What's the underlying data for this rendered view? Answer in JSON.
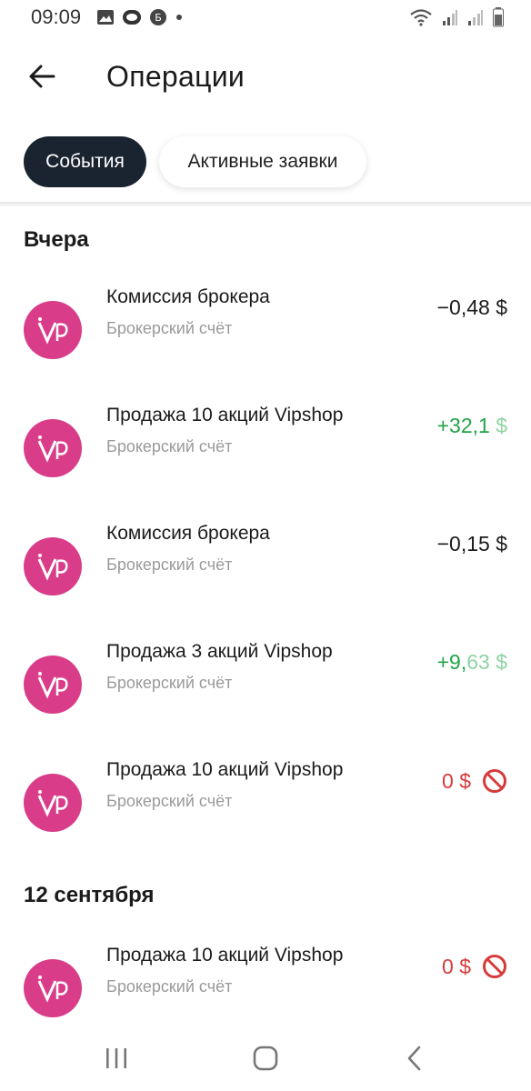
{
  "status_bar": {
    "time": "09:09",
    "left_icons": [
      "image-icon",
      "ring-icon",
      "b-badge-icon",
      "dot-icon"
    ],
    "b_badge_text": "Б",
    "right_icons": [
      "wifi-icon",
      "signal-icon",
      "signal-icon",
      "battery-icon"
    ]
  },
  "header": {
    "title": "Операции"
  },
  "tabs": [
    {
      "label": "События",
      "active": true
    },
    {
      "label": "Активные заявки",
      "active": false
    }
  ],
  "sections": [
    {
      "title": "Вчера",
      "items": [
        {
          "title": "Комиссия брокера",
          "subtitle": "Брокерский счёт",
          "amount": "−0,48 $",
          "type": "negative"
        },
        {
          "title": "Продажа 10 акций Vipshop",
          "subtitle": "Брокерский счёт",
          "amount_main": "+32,1",
          "amount_fade": " $",
          "type": "positive"
        },
        {
          "title": "Комиссия брокера",
          "subtitle": "Брокерский счёт",
          "amount": "−0,15 $",
          "type": "negative"
        },
        {
          "title": "Продажа 3 акций Vipshop",
          "subtitle": "Брокерский счёт",
          "amount_main": "+9,",
          "amount_fade": "63 $",
          "type": "positive"
        },
        {
          "title": "Продажа 10 акций Vipshop",
          "subtitle": "Брокерский счёт",
          "amount": "0 $",
          "type": "cancelled",
          "icon": "cancelled-icon"
        }
      ]
    },
    {
      "title": "12 сентября",
      "items": [
        {
          "title": "Продажа 10 акций Vipshop",
          "subtitle": "Брокерский счёт",
          "amount": "0 $",
          "type": "cancelled",
          "icon": "cancelled-icon"
        }
      ]
    }
  ],
  "logo": {
    "text": "VIP",
    "color": "#d93d8a"
  },
  "colors": {
    "positive": "#22a447",
    "cancelled": "#d63b3b",
    "active_tab": "#1a2330"
  },
  "nav_bar": [
    "recent-apps-icon",
    "home-icon",
    "back-icon"
  ]
}
